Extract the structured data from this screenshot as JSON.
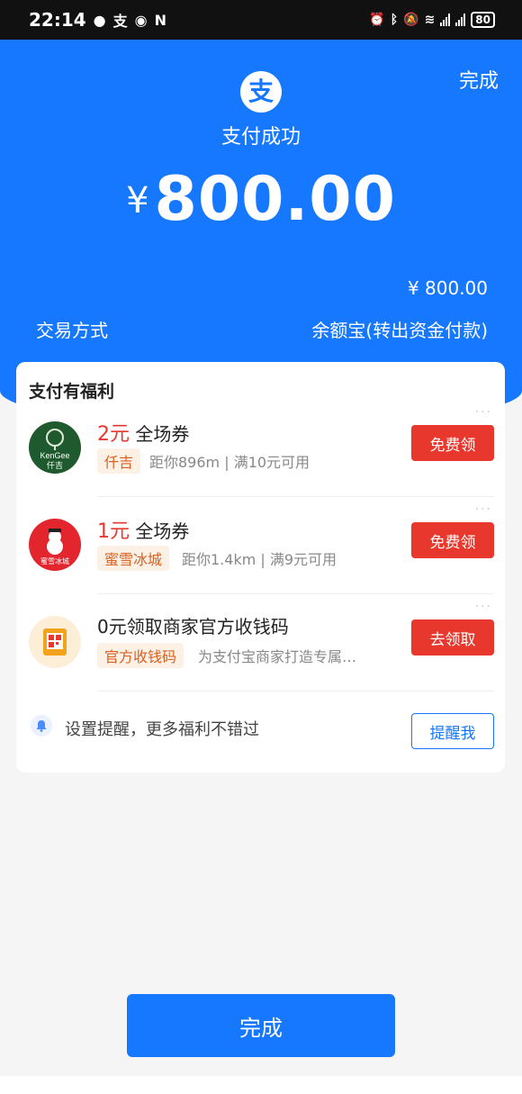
{
  "status_bar": {
    "time": "22:14",
    "battery": "80"
  },
  "header": {
    "done_label": "完成",
    "logo_char": "支",
    "title": "支付成功",
    "currency": "¥",
    "amount": "800.00",
    "small_amount": "¥ 800.00",
    "method_label": "交易方式",
    "method_value": "余额宝(转出资金付款)"
  },
  "benefits": {
    "title": "支付有福利",
    "items": [
      {
        "highlight": "2元",
        "title": " 全场券",
        "tag": "仟吉",
        "desc": "距你896m | 满10元可用",
        "button": "免费领",
        "logo_text_1": "KenGee",
        "logo_text_2": "仟吉",
        "color": "#1f5a2e"
      },
      {
        "highlight": "1元",
        "title": " 全场券",
        "tag": "蜜雪冰城",
        "desc": "距你1.4km | 满9元可用",
        "button": "免费领",
        "logo_text_1": "蜜雪冰城",
        "color": "#e3262d"
      },
      {
        "highlight": "",
        "title": "0元领取商家官方收钱码",
        "tag": "官方收钱码",
        "desc": "为支付宝商家打造专属…",
        "button": "去领取",
        "color": "#f2a21b"
      }
    ],
    "remind_text": "设置提醒，更多福利不错过",
    "remind_button": "提醒我"
  },
  "footer": {
    "done_label": "完成"
  },
  "colors": {
    "brand_blue": "#1677ff",
    "accent_red": "#e8382e",
    "tag_orange": "#d9601f"
  }
}
